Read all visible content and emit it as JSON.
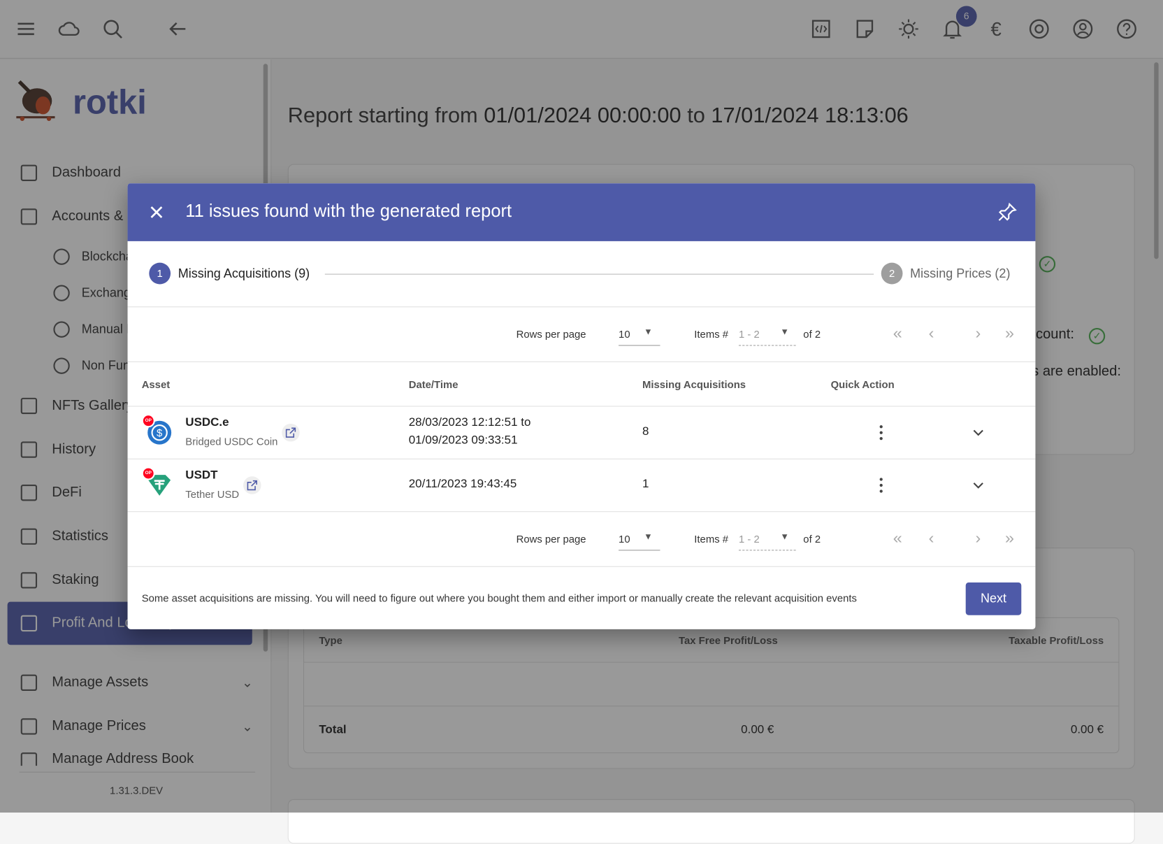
{
  "topbar": {
    "notification_count": "6",
    "icons": [
      "menu-icon",
      "cloud-icon",
      "search-icon",
      "back-arrow-icon",
      "code-icon",
      "notes-icon",
      "theme-icon",
      "bell-icon",
      "euro-icon",
      "eye-icon",
      "account-icon",
      "help-icon"
    ]
  },
  "sidebar": {
    "brand": "rotki",
    "items": [
      {
        "label": "Dashboard"
      },
      {
        "label": "Accounts & Balances"
      },
      {
        "label": "Blockchain"
      },
      {
        "label": "Exchanges"
      },
      {
        "label": "Manual Balances"
      },
      {
        "label": "Non Fungible Balances"
      },
      {
        "label": "NFTs Gallery"
      },
      {
        "label": "History"
      },
      {
        "label": "DeFi"
      },
      {
        "label": "Statistics"
      },
      {
        "label": "Staking"
      },
      {
        "label": "Profit And Loss Report"
      },
      {
        "label": "Manage Assets"
      },
      {
        "label": "Manage Prices"
      },
      {
        "label": "Manage Address Book"
      }
    ],
    "version": "1.31.3.DEV"
  },
  "main": {
    "title_prefix": "Report starting from",
    "start": "01/01/2024 00:00:00",
    "to": "to",
    "end": "17/01/2024 18:13:06",
    "bg_text1": "ccount:",
    "bg_text2": "s are enabled:",
    "summary": {
      "headers": [
        "Type",
        "Tax Free Profit/Loss",
        "Taxable Profit/Loss"
      ],
      "total_label": "Total",
      "tax_free_total": "0.00 €",
      "taxable_total": "0.00 €"
    }
  },
  "dialog": {
    "title": "11 issues found with the generated report",
    "steps": [
      {
        "num": "1",
        "label": "Missing Acquisitions (9)"
      },
      {
        "num": "2",
        "label": "Missing Prices (2)"
      }
    ],
    "pagination": {
      "rows_label": "Rows per page",
      "rows_value": "10",
      "items_label": "Items #",
      "items_value": "1 - 2",
      "of": "of 2"
    },
    "headers": [
      "Asset",
      "Date/Time",
      "Missing Acquisitions",
      "Quick Action"
    ],
    "rows": [
      {
        "symbol": "USDC.e",
        "name": "Bridged USDC Coin",
        "date1": "28/03/2023 12:12:51 to",
        "date2": "01/09/2023 09:33:51",
        "missing": "8",
        "chain_badge": "OP"
      },
      {
        "symbol": "USDT",
        "name": "Tether USD",
        "date1": "20/11/2023 19:43:45",
        "date2": "",
        "missing": "1",
        "chain_badge": "OP"
      }
    ],
    "footer_text": "Some asset acquisitions are missing. You will need to figure out where you bought them and either import or manually create the relevant acquisition events",
    "next_label": "Next"
  },
  "colors": {
    "primary": "#4e5aa8",
    "success": "#4caf50",
    "usdc": "#2775ca",
    "usdt": "#26a17b",
    "op": "#ff0420"
  }
}
